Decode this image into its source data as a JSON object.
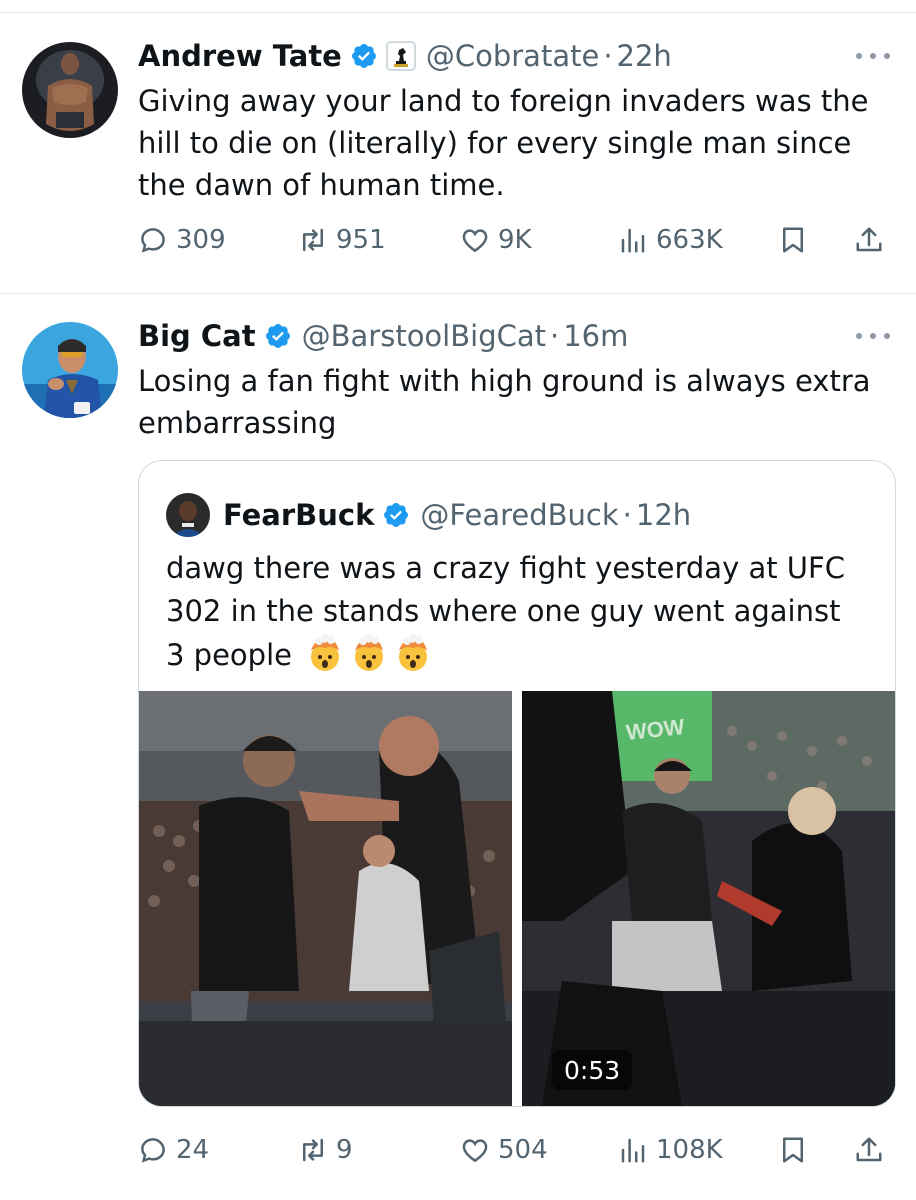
{
  "tweets": [
    {
      "name": "Andrew Tate",
      "handle": "@Cobratate",
      "dot": "·",
      "time": "22h",
      "text": "Giving away your land to foreign invaders was the hill to die on (literally) for every single man since the dawn of human time.",
      "replies": "309",
      "reposts": "951",
      "likes": "9K",
      "views": "663K"
    },
    {
      "name": "Big Cat",
      "handle": "@BarstoolBigCat",
      "dot": "·",
      "time": "16m",
      "text": "Losing a fan fight with high ground is always extra embarrassing",
      "replies": "24",
      "reposts": "9",
      "likes": "504",
      "views": "108K",
      "quote": {
        "name": "FearBuck",
        "handle": "@FearedBuck",
        "dot": "·",
        "time": "12h",
        "text": "dawg there was a crazy fight yesterday at UFC 302 in the stands where one guy went against 3 people",
        "emojis": [
          "exploding-head",
          "exploding-head",
          "exploding-head"
        ],
        "video_duration": "0:53",
        "screen_text": "WOW"
      }
    }
  ],
  "icons": [
    "reply-icon",
    "repost-icon",
    "like-icon",
    "views-icon",
    "bookmark-icon",
    "share-icon",
    "verified-icon",
    "more-icon"
  ],
  "colors": {
    "verified": "#1d9bf0",
    "muted": "#536471",
    "text": "#0f1419",
    "border": "#cfd9de"
  }
}
